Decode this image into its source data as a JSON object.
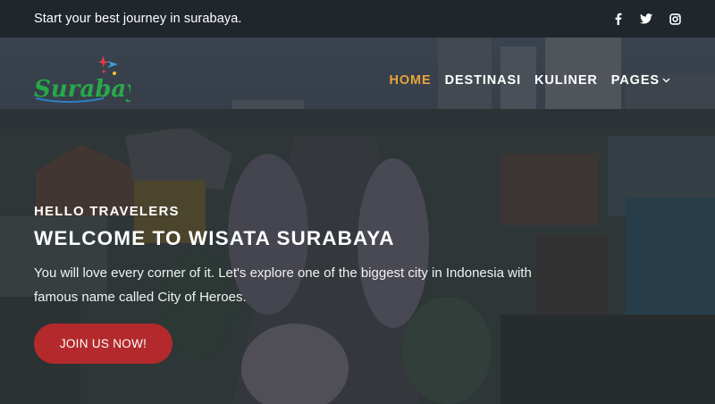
{
  "topbar": {
    "tagline": "Start your best journey in surabaya.",
    "social": [
      {
        "icon": "facebook-icon",
        "glyph": "f"
      },
      {
        "icon": "twitter-icon",
        "glyph": "t"
      },
      {
        "icon": "instagram-icon",
        "glyph": "ig"
      }
    ]
  },
  "brand": {
    "logo_text": "Surabaya"
  },
  "nav": {
    "items": [
      {
        "label": "HOME",
        "active": true
      },
      {
        "label": "DESTINASI",
        "active": false
      },
      {
        "label": "KULINER",
        "active": false
      },
      {
        "label": "PAGES",
        "active": false,
        "dropdown": true
      }
    ]
  },
  "hero": {
    "kicker": "HELLO TRAVELERS",
    "headline": "WELCOME TO WISATA SURABAYA",
    "description": "You will love every corner of it. Let's explore one of the biggest city in Indonesia with famous name called City of Heroes.",
    "cta_label": "JOIN US NOW!"
  },
  "colors": {
    "accent": "#e8a33c",
    "cta": "#b3292c",
    "topbar": "#1f262c"
  }
}
